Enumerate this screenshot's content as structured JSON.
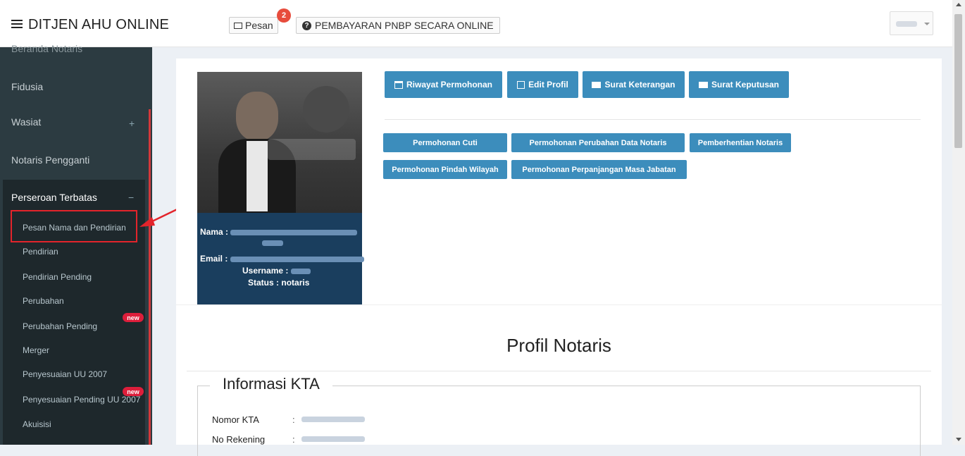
{
  "topbar": {
    "brand": "DITJEN AHU ONLINE",
    "pesan_label": "Pesan",
    "pesan_count": "2",
    "pnbp_label": "PEMBAYARAN PNBP SECARA ONLINE",
    "pnbp_icon": "question-circle-icon"
  },
  "sidebar": {
    "top_cut": "Beranda Notaris",
    "items": [
      {
        "label": "Fidusia"
      },
      {
        "label": "Wasiat",
        "toggle": "+"
      },
      {
        "label": "Notaris Pengganti"
      }
    ],
    "group": {
      "label": "Perseroan Terbatas",
      "toggle": "−",
      "sub_items": [
        {
          "label": "Pesan Nama dan Pendirian"
        },
        {
          "label": "Pendirian"
        },
        {
          "label": "Pendirian Pending"
        },
        {
          "label": "Perubahan"
        },
        {
          "label": "Perubahan Pending",
          "badge": "new"
        },
        {
          "label": "Merger"
        },
        {
          "label": "Penyesuaian UU 2007"
        },
        {
          "label": "Penyesuaian Pending UU 2007",
          "badge": "new"
        },
        {
          "label": "Akuisisi"
        }
      ]
    }
  },
  "profile": {
    "nama_label": "Nama :",
    "email_label": "Email :",
    "username_label": "Username :",
    "status_label": "Status :",
    "status_value": "notaris"
  },
  "actions": {
    "riwayat": "Riwayat Permohonan",
    "edit": "Edit Profil",
    "surat_keterangan": "Surat Keterangan",
    "surat_keputusan": "Surat Keputusan"
  },
  "requests": {
    "cuti": "Permohonan Cuti",
    "perubahan_data": "Permohonan Perubahan Data Notaris",
    "pemberhentian": "Pemberhentian Notaris",
    "pindah_wilayah": "Permohonan Pindah Wilayah",
    "perpanjangan": "Permohonan Perpanjangan Masa Jabatan"
  },
  "main": {
    "title": "Profil Notaris",
    "section_title": "Informasi KTA",
    "fields": [
      {
        "label": "Nomor KTA",
        "sep": ":"
      },
      {
        "label": "No Rekening",
        "sep": ":"
      }
    ]
  },
  "colors": {
    "primary": "#3c8dbc",
    "sidebar_bg": "#2c3b41",
    "highlight": "#e3242b",
    "badge": "#dd1e3b"
  }
}
